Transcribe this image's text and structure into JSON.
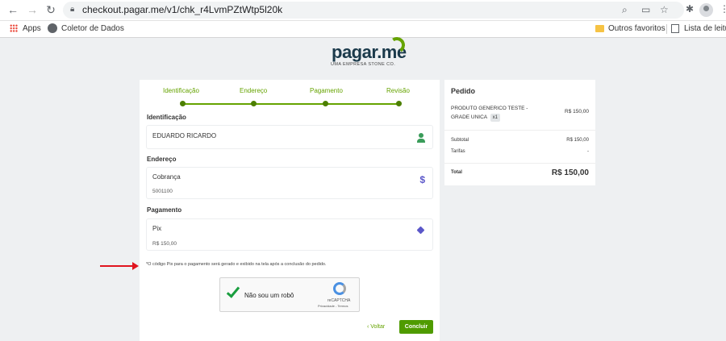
{
  "browser": {
    "url": "checkout.pagar.me/v1/chk_r4LvmPZtWtp5l20k",
    "bookmarks": {
      "apps": "Apps",
      "coletor": "Coletor de Dados",
      "outros": "Outros favoritos",
      "lista": "Lista de leitura"
    }
  },
  "logo": {
    "name": "pagar.me",
    "tagline": "UMA EMPRESA STONE CO.",
    "accent": "#65a300"
  },
  "steps": [
    "Identificação",
    "Endereço",
    "Pagamento",
    "Revisão"
  ],
  "identificacao": {
    "title": "Identificação",
    "name": "EDUARDO RICARDO"
  },
  "endereco": {
    "title": "Endereço",
    "type": "Cobrança",
    "cep": "5001100"
  },
  "pagamento": {
    "title": "Pagamento",
    "method": "Pix",
    "amount": "R$ 150,00"
  },
  "note": "*O código Pix para o pagamento será gerado e exibido na tela após a conclusão do pedido.",
  "captcha": {
    "label": "Não sou um robô",
    "brand": "reCAPTCHA",
    "links": "Privacidade - Termos"
  },
  "actions": {
    "back": "‹ Voltar",
    "submit": "Concluir"
  },
  "order": {
    "title": "Pedido",
    "product": "PRODUTO GENERICO TESTE - GRADE UNICA",
    "qty": "x1",
    "product_price": "R$ 150,00",
    "subtotal_label": "Subtotal",
    "subtotal_value": "R$ 150,00",
    "tarifas_label": "Tarifas",
    "tarifas_value": "-",
    "total_label": "Total",
    "total_value": "R$ 150,00"
  },
  "colors": {
    "green": "#65a300",
    "purple_icon": "#5b57c9",
    "annotation_arrow": "#e0141e"
  }
}
